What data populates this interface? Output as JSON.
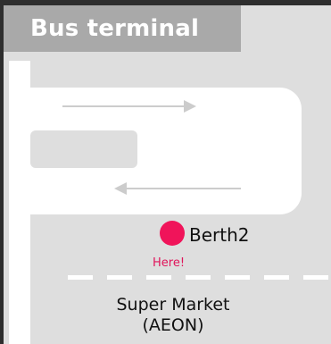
{
  "title": "Bus terminal",
  "berth": {
    "label": "Berth2",
    "here_label": "Here!",
    "marker_color": "#f0145a"
  },
  "landmark": {
    "line1": "Super Market",
    "line2": "(AEON)"
  },
  "colors": {
    "road": "#ffffff",
    "ground": "#dedede",
    "frame": "#2e2e2e",
    "badge": "#a9a9a9",
    "arrow": "#cccccc",
    "here_text": "#e0145a"
  },
  "icons": {
    "traffic_direction": "arrow-icon",
    "location": "location-dot-icon"
  }
}
